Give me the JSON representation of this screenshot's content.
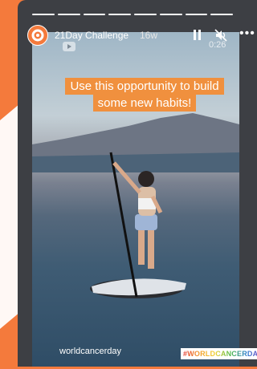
{
  "story": {
    "account_name": "21Day Challenge",
    "age": "16w",
    "timestamp": "0:26",
    "progress_segments": 8,
    "progress_done": 8,
    "caption": "Use this opportunity to build some new habits!",
    "handle": "worldcancerday",
    "hashtag": "#WORLDCANCERDAY"
  },
  "icons": {
    "avatar": "brand-logo-icon",
    "pause": "pause-icon",
    "mute": "mute-icon",
    "more": "more-icon",
    "video_source": "youtube-icon"
  },
  "colors": {
    "backdrop": "#f47a3c",
    "caption_bg": "#f0903e",
    "frame": "#3d3f44"
  }
}
